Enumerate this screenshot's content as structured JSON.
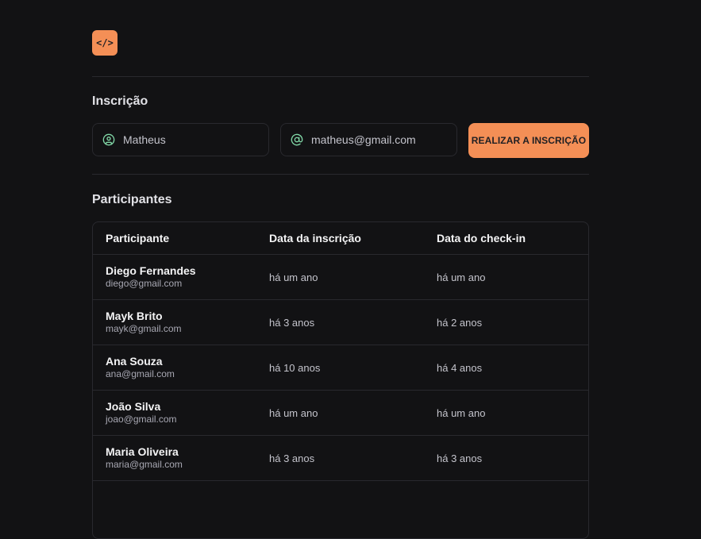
{
  "logo": {
    "glyph": "</>"
  },
  "registration": {
    "title": "Inscrição",
    "name_value": "Matheus",
    "email_value": "matheus@gmail.com",
    "submit_label": "REALIZAR A INSCRIÇÃO"
  },
  "participants": {
    "title": "Participantes",
    "columns": [
      "Participante",
      "Data da inscrição",
      "Data do check-in"
    ],
    "rows": [
      {
        "name": "Diego Fernandes",
        "email": "diego@gmail.com",
        "registered": "há um ano",
        "checkin": "há um ano"
      },
      {
        "name": "Mayk Brito",
        "email": "mayk@gmail.com",
        "registered": "há 3 anos",
        "checkin": "há 2 anos"
      },
      {
        "name": "Ana Souza",
        "email": "ana@gmail.com",
        "registered": "há 10 anos",
        "checkin": "há 4 anos"
      },
      {
        "name": "João Silva",
        "email": "joao@gmail.com",
        "registered": "há um ano",
        "checkin": "há um ano"
      },
      {
        "name": "Maria Oliveira",
        "email": "maria@gmail.com",
        "registered": "há 3 anos",
        "checkin": "há 3 anos"
      }
    ]
  },
  "colors": {
    "accent": "#f48f56",
    "background": "#121214",
    "border": "#29292e",
    "icon": "#81d8a7"
  }
}
